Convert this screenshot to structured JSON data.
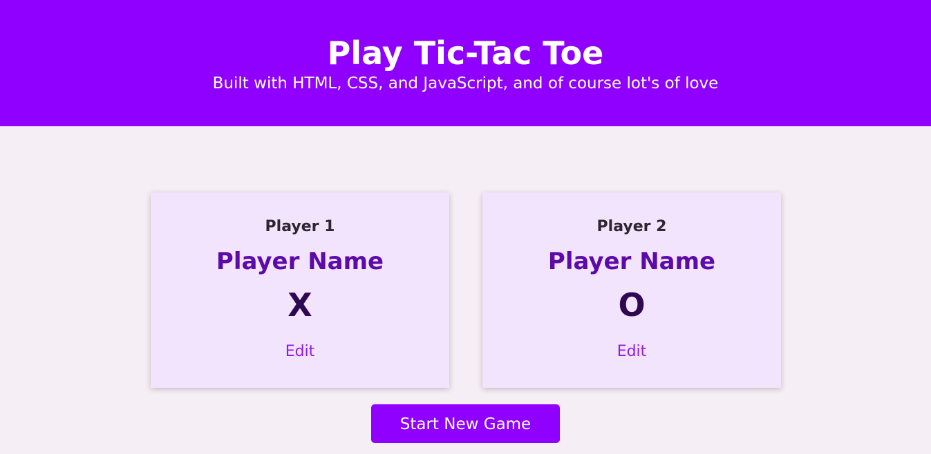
{
  "header": {
    "title": "Play Tic-Tac Toe",
    "subtitle": "Built with HTML, CSS, and JavaScript, and of course lot's of love"
  },
  "players": [
    {
      "label": "Player 1",
      "name": "Player Name",
      "symbol": "X",
      "edit_label": "Edit"
    },
    {
      "label": "Player 2",
      "name": "Player Name",
      "symbol": "O",
      "edit_label": "Edit"
    }
  ],
  "start_button": {
    "label": "Start New Game"
  },
  "colors": {
    "primary": "#8f00ff",
    "background": "#f6eef5",
    "card_background": "#f3e4fd",
    "player_name": "#5c0aa8",
    "symbol": "#2f0852",
    "edit_link": "#8f1be8",
    "label_text": "#2d2630",
    "header_text": "#ffffff"
  }
}
